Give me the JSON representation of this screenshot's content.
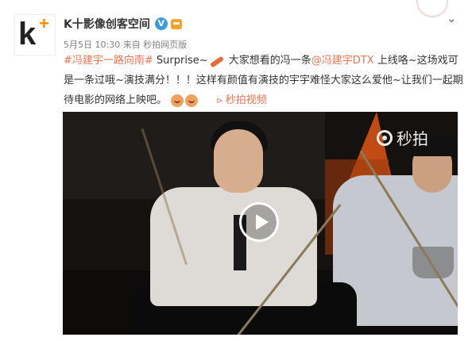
{
  "author": {
    "name": "K十影像创客空间",
    "verified_icon": "verified-v-badge",
    "level_icon": "crown-badge-icon"
  },
  "meta": {
    "date": "5月5日 10:30",
    "from": "来自 秒拍网页版"
  },
  "post": {
    "topic": "#冯建宇一路向南#",
    "t1": " Surprise~",
    "t2": " 大家想看的冯一条",
    "mention1": "@冯建宇DTX",
    "t3": " 上线咯~这场戏可是一条过哦~演技满分！！！这样有颜值有演技的宇宇难怪大家这么爱他~让我们一起期待电影的网络上映吧。",
    "video_link": "秒拍视频"
  },
  "video": {
    "watermark": "秒拍",
    "play_icon": "play-circle-icon"
  },
  "colors": {
    "link": "#eb7350",
    "verified": "#3a9be0",
    "accent": "#ff8a00"
  }
}
